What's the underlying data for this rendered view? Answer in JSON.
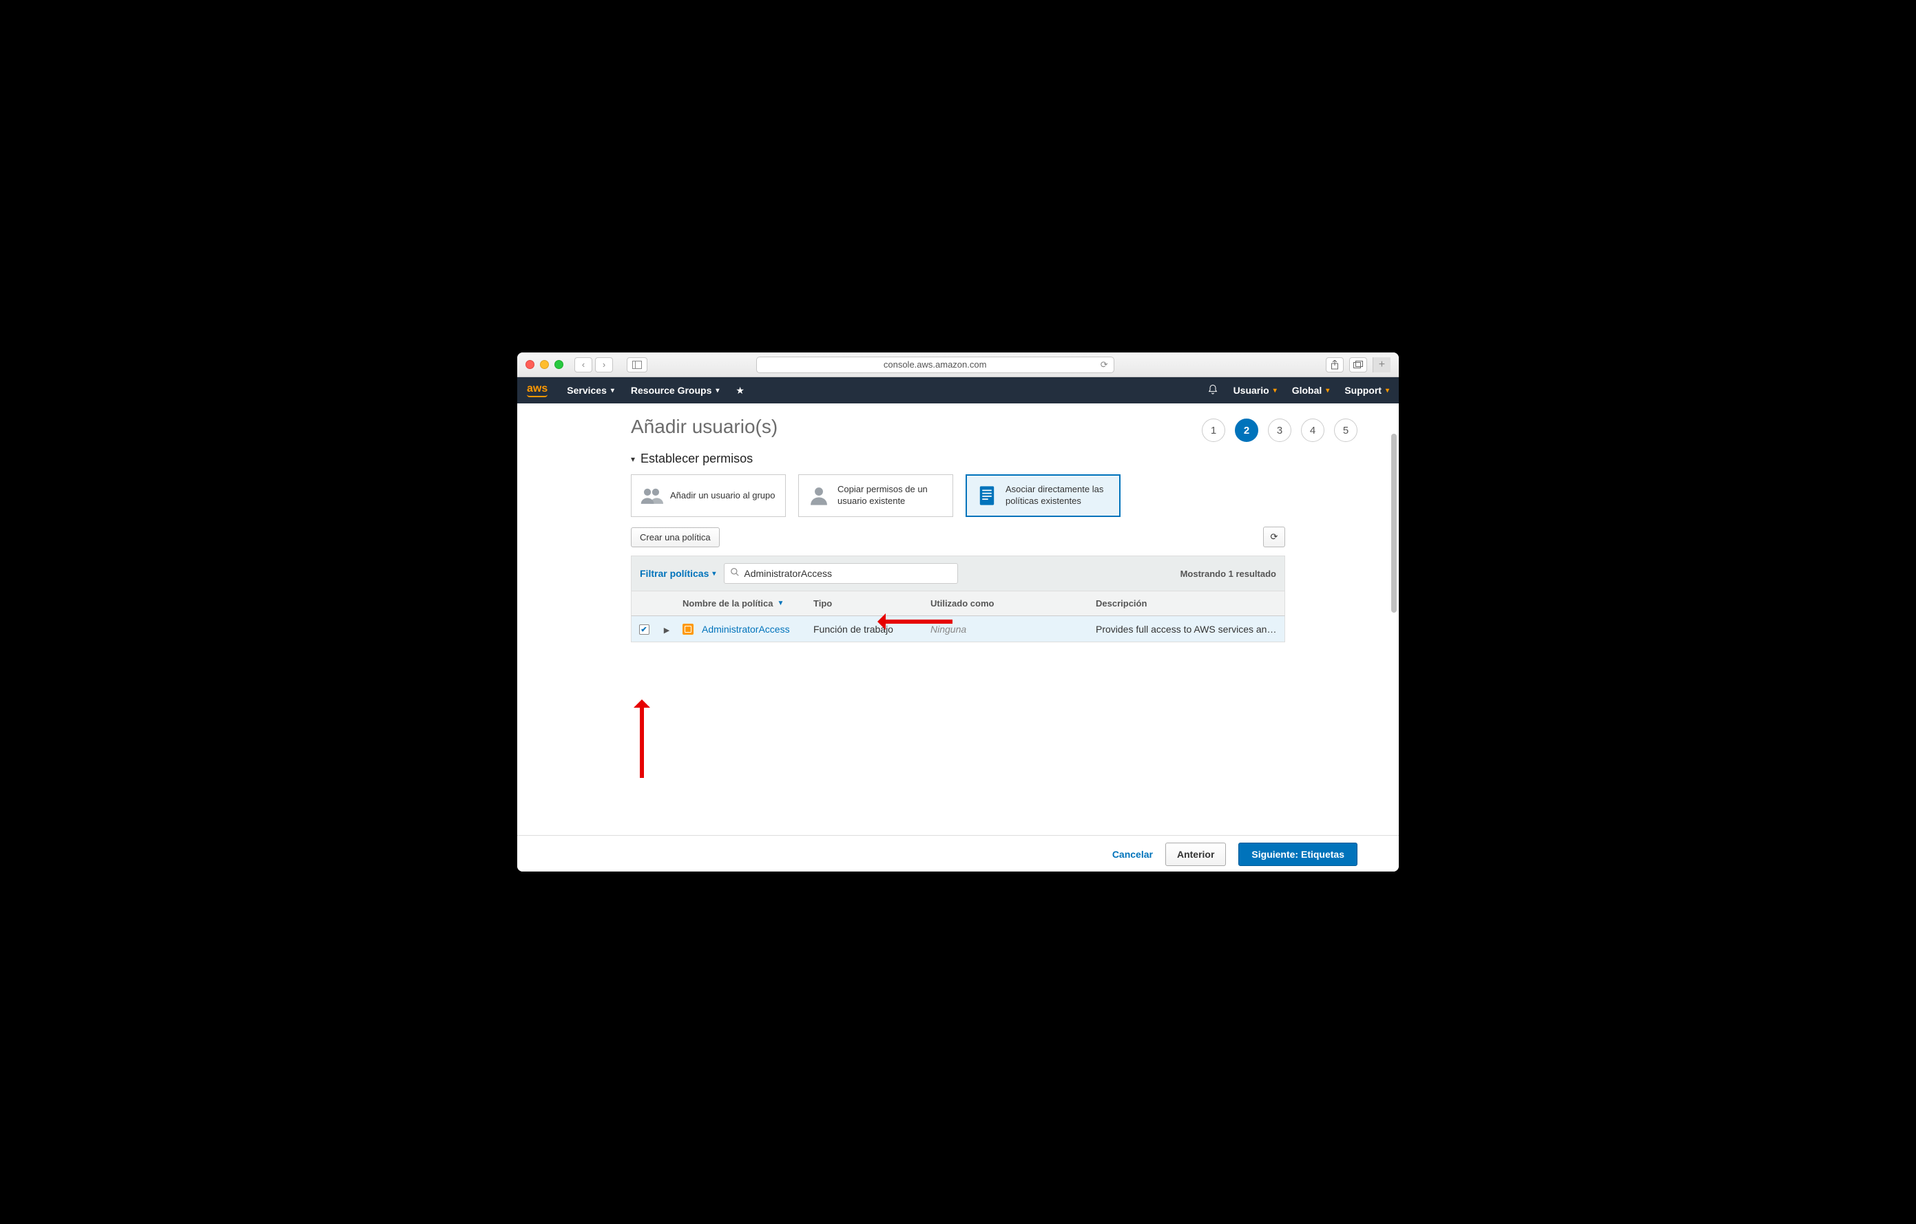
{
  "browser": {
    "address": "console.aws.amazon.com"
  },
  "header": {
    "menu_services": "Services",
    "menu_resource_groups": "Resource Groups",
    "user": "Usuario",
    "region": "Global",
    "support": "Support"
  },
  "page": {
    "title": "Añadir usuario(s)",
    "section_permissions": "Establecer permisos"
  },
  "steps": {
    "s1": "1",
    "s2": "2",
    "s3": "3",
    "s4": "4",
    "s5": "5",
    "active": 2
  },
  "cards": {
    "group": "Añadir un usuario al grupo",
    "copy": "Copiar permisos de un usuario existente",
    "attach": "Asociar directamente las políticas existentes"
  },
  "toolbar": {
    "create_policy": "Crear una política"
  },
  "filter": {
    "filter_label": "Filtrar políticas",
    "search_value": "AdministratorAccess",
    "result_count": "Mostrando 1 resultado"
  },
  "table": {
    "col_name": "Nombre de la política",
    "col_type": "Tipo",
    "col_used": "Utilizado como",
    "col_desc": "Descripción",
    "row": {
      "name": "AdministratorAccess",
      "type": "Función de trabajo",
      "used": "Ninguna",
      "desc": "Provides full access to AWS services an…",
      "checked": true
    }
  },
  "footer": {
    "cancel": "Cancelar",
    "prev": "Anterior",
    "next": "Siguiente: Etiquetas"
  }
}
